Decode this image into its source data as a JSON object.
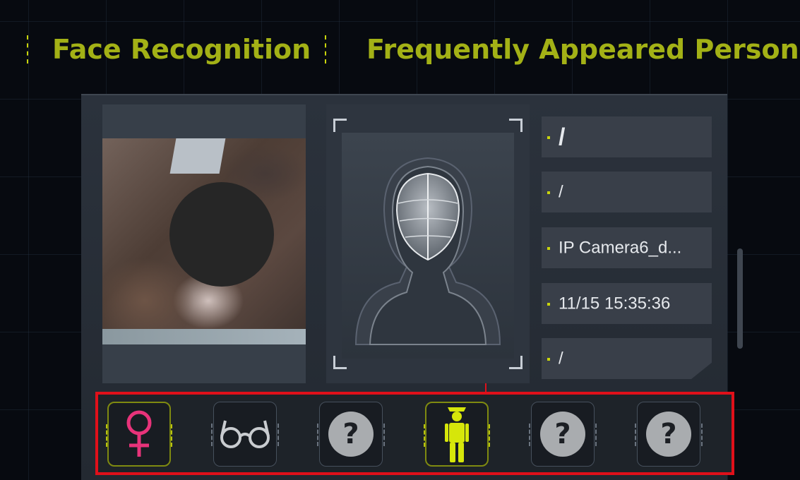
{
  "header": {
    "tab_face_recognition": "Face Recognition",
    "tab_frequently_appeared": "Frequently Appeared Person"
  },
  "info": {
    "row1": "/",
    "row2": "/",
    "camera": "IP Camera6_d...",
    "time": "11/15 15:35:36",
    "row5": "/"
  },
  "attributes": {
    "q": "?"
  },
  "colors": {
    "accent": "#a3b116",
    "highlight_red": "#e0101a",
    "female_icon": "#e8337a",
    "person_icon": "#d6e60a"
  },
  "icons": [
    "female-icon",
    "glasses-icon",
    "unknown-icon",
    "person-icon",
    "unknown-icon",
    "unknown-icon"
  ]
}
